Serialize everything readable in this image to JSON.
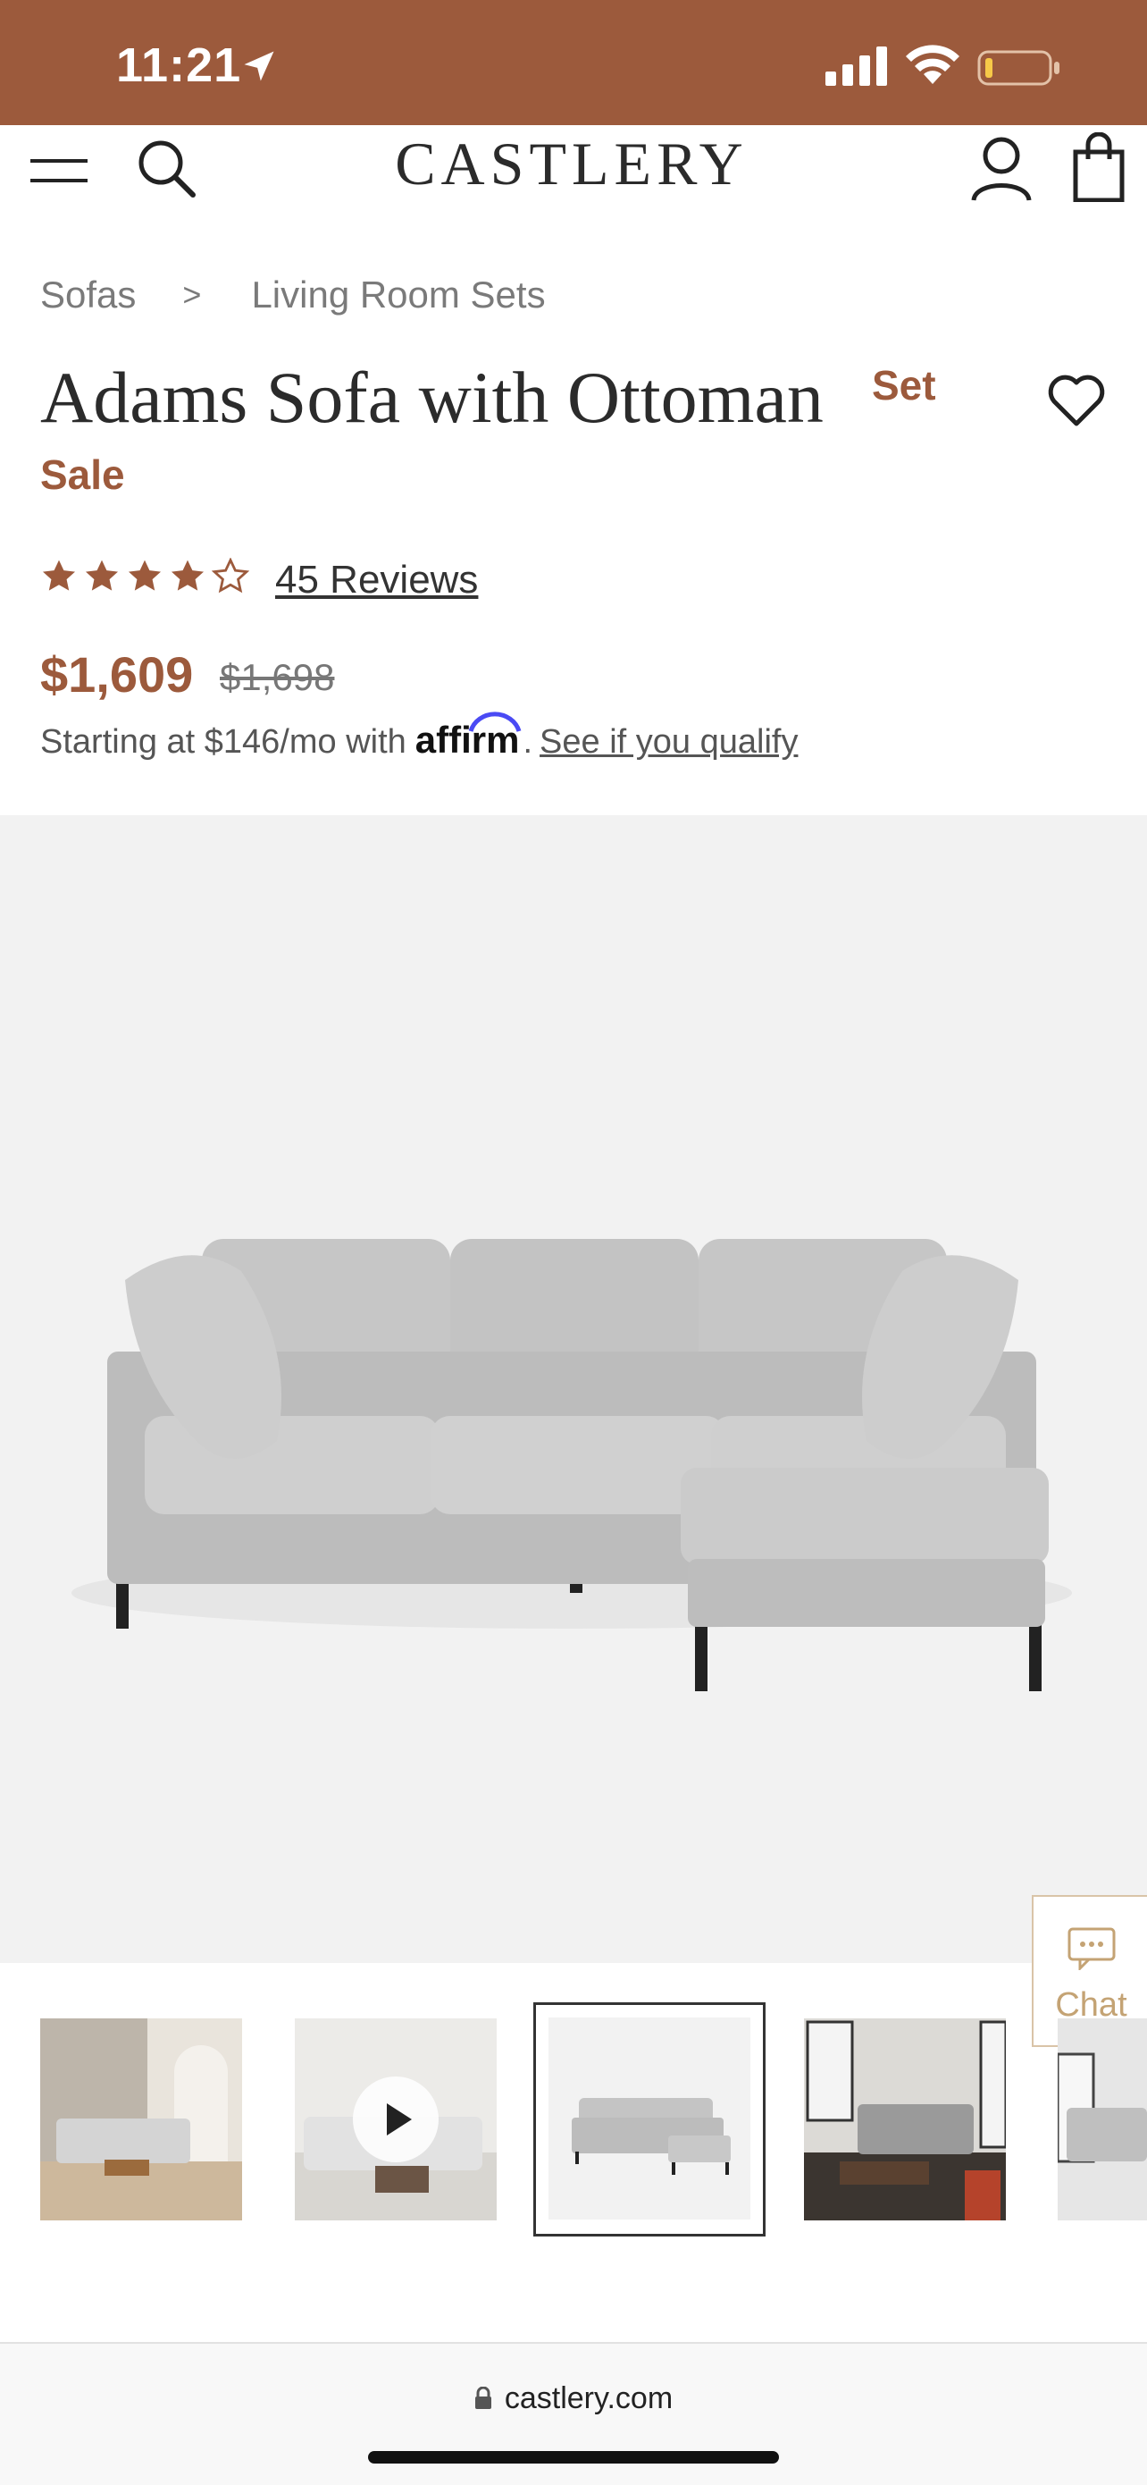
{
  "status_bar": {
    "time": "11:21",
    "icons": [
      "location-arrow-icon",
      "cellular-signal-icon",
      "wifi-icon",
      "battery-low-icon"
    ],
    "background_color": "#9c5a3c"
  },
  "header": {
    "logo": "CASTLERY",
    "icons": [
      "hamburger-menu-icon",
      "search-icon",
      "account-icon",
      "shopping-bag-icon"
    ]
  },
  "breadcrumb": {
    "items": [
      "Sofas",
      "Living Room Sets"
    ],
    "separator": ">"
  },
  "product": {
    "title": "Adams Sofa with Ottoman",
    "title_badge": "Set",
    "sale_label": "Sale",
    "rating": 4.5,
    "rating_max": 5,
    "reviews_label": "45 Reviews",
    "price": "$1,609",
    "original_price": "$1,698",
    "financing_prefix": "Starting at $146/mo with",
    "financing_brand": "affirm",
    "financing_suffix": ".",
    "financing_link": "See if you qualify",
    "accent_color": "#9c5a3c"
  },
  "gallery": {
    "main_image": "grey-sofa-with-ottoman",
    "thumbnails": [
      {
        "name": "room-scene-1",
        "active": false
      },
      {
        "name": "video-thumbnail",
        "active": false,
        "has_play": true
      },
      {
        "name": "grey-sofa-studio",
        "active": true
      },
      {
        "name": "room-scene-2",
        "active": false
      },
      {
        "name": "room-scene-3",
        "active": false
      }
    ]
  },
  "chat": {
    "label": "Chat"
  },
  "browser": {
    "url": "castlery.com"
  }
}
